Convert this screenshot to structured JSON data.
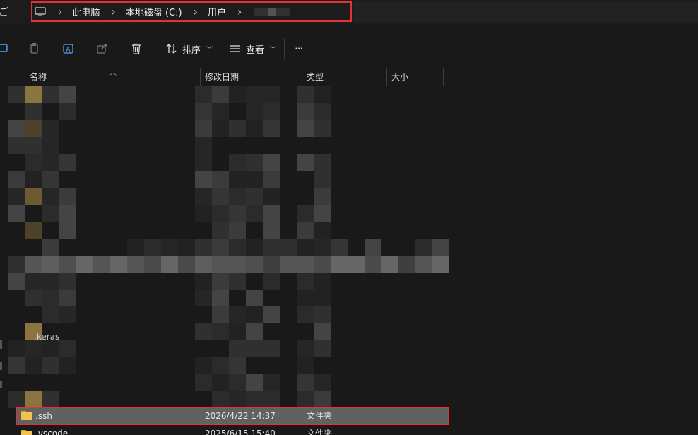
{
  "left_glyph": "ご",
  "address_bar": {
    "breadcrumbs": [
      "此电脑",
      "本地磁盘 (C:)",
      "用户"
    ],
    "current_user_partial": "_"
  },
  "toolbar": {
    "sort_label": "排序",
    "view_label": "查看",
    "more_label": "···"
  },
  "columns": {
    "name": "名称",
    "modified": "修改日期",
    "type": "类型",
    "size": "大小"
  },
  "rows": [
    {
      "name": ".keras",
      "modified": "",
      "type": ""
    },
    {
      "name": ".ssh",
      "modified": "2026/4/22 14:37",
      "type": "文件夹",
      "selected": true
    },
    {
      "name": ".vscode",
      "modified": "2025/6/15 15:40",
      "type": "文件夹"
    }
  ],
  "colors": {
    "highlight_border": "#e53131",
    "folder": "#f2c14e",
    "selected_row": "#616161",
    "background": "#191919"
  }
}
